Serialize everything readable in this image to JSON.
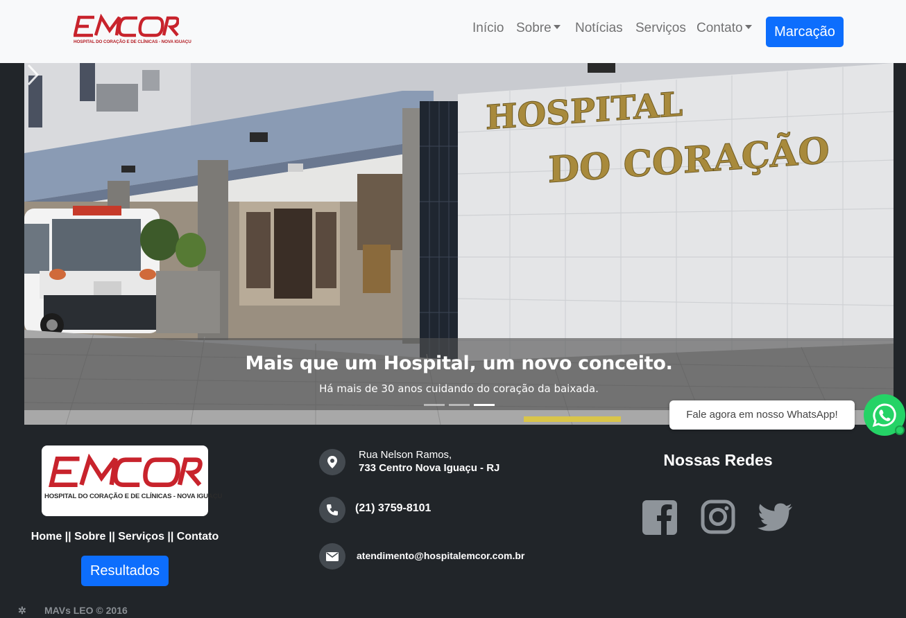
{
  "brand": {
    "logo_text": "EMCOR",
    "tagline": "HOSPITAL DO CORAÇÃO E DE CLÍNICAS - NOVA IGUAÇU",
    "color": "#c8232c"
  },
  "nav": {
    "items": [
      {
        "label": "Início"
      },
      {
        "label": "Sobre"
      },
      {
        "label": "Notícias"
      },
      {
        "label": "Serviços"
      },
      {
        "label": "Contato"
      }
    ],
    "cta_label": "Marcação"
  },
  "hero": {
    "sign_line1": "HOSPITAL",
    "sign_line2": "DO CORAÇÃO",
    "title": "Mais que um Hospital, um novo conceito.",
    "subtitle": "Há mais de 30 anos cuidando do coração da baixada.",
    "slides_total": 3,
    "active_slide": 3
  },
  "footer": {
    "links": "Home || Sobre || Serviços || Contato",
    "results_label": "Resultados",
    "address_line1": "Rua Nelson Ramos,",
    "address_line2": "733 Centro Nova Iguaçu - RJ",
    "phone": "(21) 3759-8101",
    "email": "atendimento@hospitalemcor.com.br",
    "redes_title": "Nossas Redes",
    "social_icons": [
      "facebook-icon",
      "instagram-icon",
      "twitter-icon"
    ],
    "copyright": "MAVs LEO © 2016"
  },
  "whatsapp": {
    "bubble_text": "Fale agora em nosso WhatsApp!",
    "color": "#25d366"
  },
  "colors": {
    "primary": "#0d6efd",
    "footer_bg": "#212529",
    "navbar_bg": "#f8f9fa"
  }
}
